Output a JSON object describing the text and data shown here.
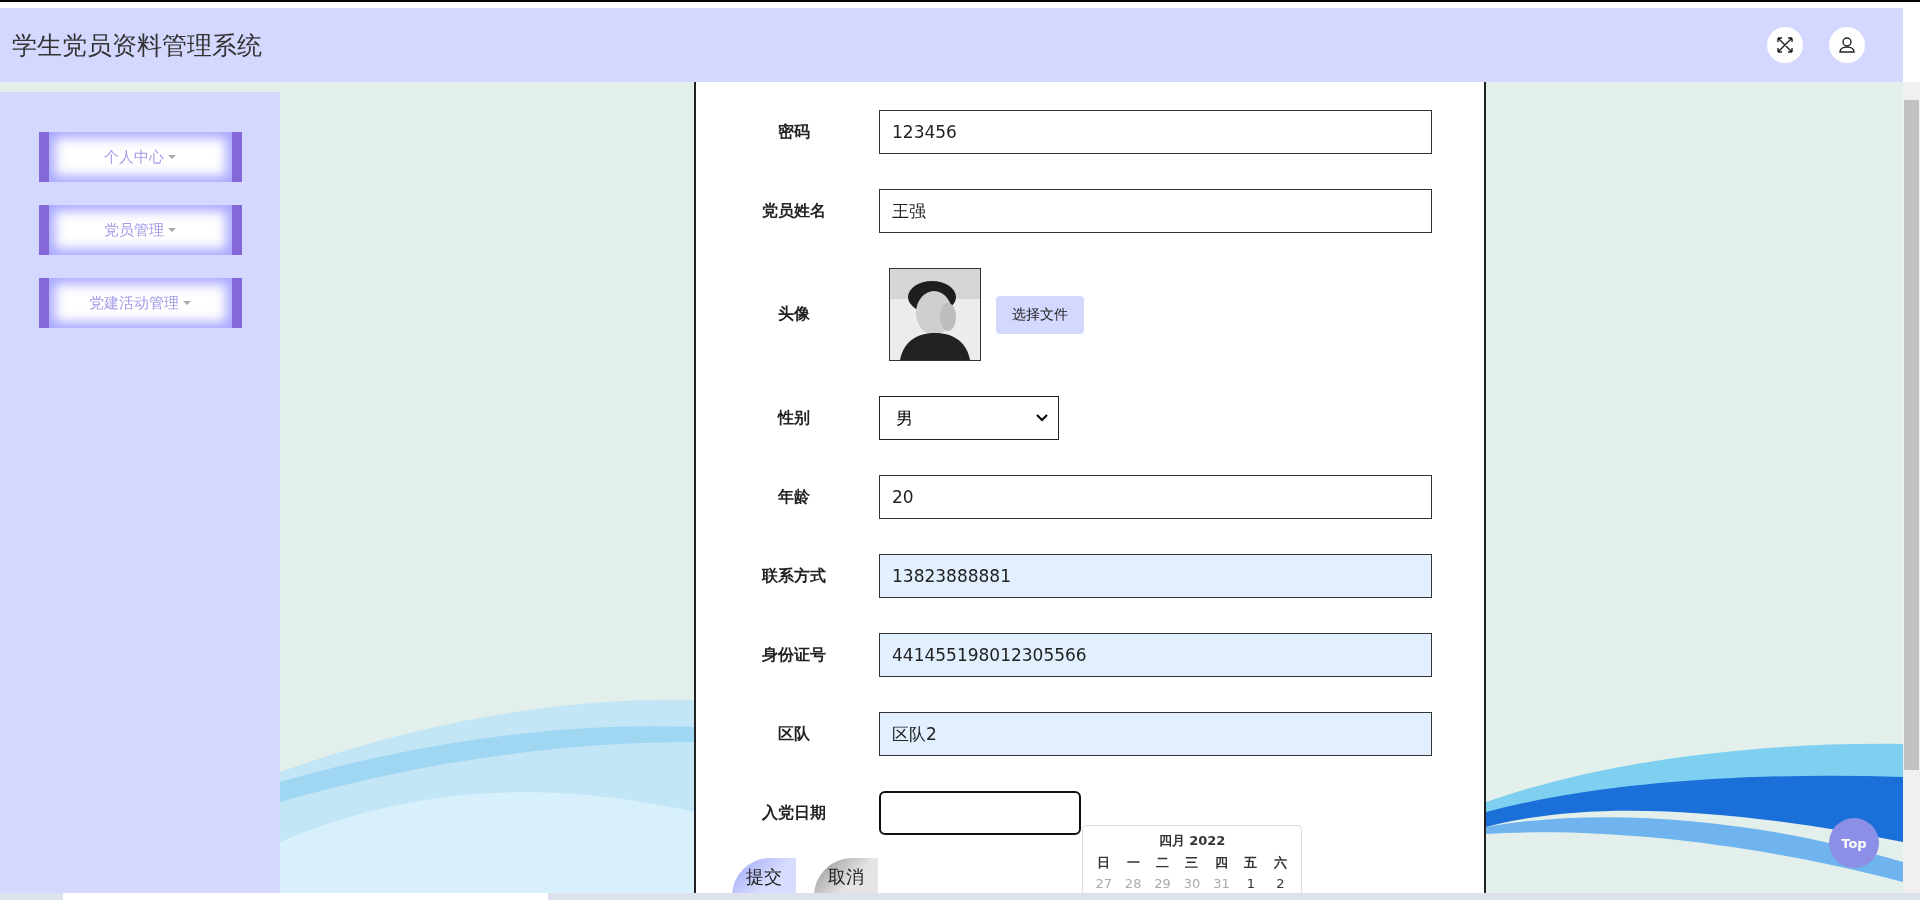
{
  "header": {
    "title": "学生党员资料管理系统"
  },
  "sidebar": {
    "items": [
      {
        "label": "个人中心"
      },
      {
        "label": "党员管理"
      },
      {
        "label": "党建活动管理"
      }
    ]
  },
  "form": {
    "fields": [
      {
        "kind": "text",
        "label": "密码",
        "value": "123456",
        "readonly": false
      },
      {
        "kind": "text",
        "label": "党员姓名",
        "value": "王强",
        "readonly": false
      },
      {
        "label": "头像",
        "button": "选择文件"
      },
      {
        "kind": "select",
        "label": "性别",
        "value": "男"
      },
      {
        "kind": "text",
        "label": "年龄",
        "value": "20",
        "readonly": false
      },
      {
        "kind": "text",
        "label": "联系方式",
        "value": "13823888881",
        "readonly": true
      },
      {
        "kind": "text",
        "label": "身份证号",
        "value": "441455198012305566",
        "readonly": true
      },
      {
        "kind": "text",
        "label": "区队",
        "value": "区队2",
        "readonly": true
      },
      {
        "kind": "date",
        "label": "入党日期",
        "focused": true
      }
    ],
    "buttons": [
      {
        "label": "提交",
        "kind": "primary"
      },
      {
        "label": "取消",
        "kind": "secondary"
      }
    ]
  },
  "date_picker": {
    "month": "四月 2022",
    "weekdays": [
      "日",
      "一",
      "二",
      "三",
      "四",
      "五",
      "六"
    ],
    "days": [
      {
        "label": "27",
        "other_month": true
      },
      {
        "label": "28",
        "other_month": true
      },
      {
        "label": "29",
        "other_month": true
      },
      {
        "label": "30",
        "other_month": true
      },
      {
        "label": "31",
        "other_month": true
      },
      {
        "label": "1",
        "other_month": false
      },
      {
        "label": "2",
        "other_month": false
      }
    ]
  },
  "back_to_top": {
    "label": "Top"
  }
}
